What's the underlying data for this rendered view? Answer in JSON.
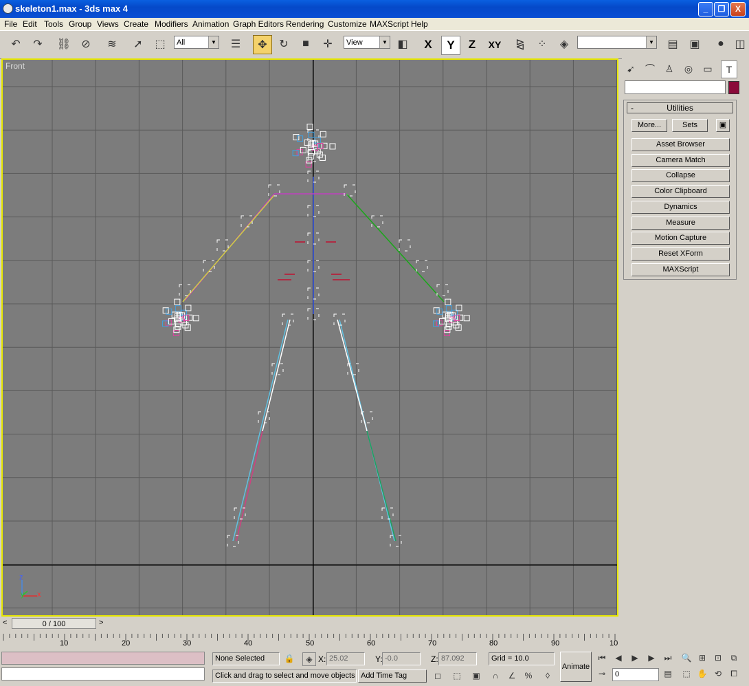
{
  "window": {
    "title": "skeleton1.max - 3ds max 4",
    "minimize": "_",
    "maximize": "❐",
    "close": "X"
  },
  "menu": [
    "File",
    "Edit",
    "Tools",
    "Group",
    "Views",
    "Create",
    "Modifiers",
    "Animation",
    "Graph Editors",
    "Rendering",
    "Customize",
    "MAXScript",
    "Help"
  ],
  "toolbar": {
    "selection_filter": "All",
    "ref_coord": "View",
    "axis_x": "X",
    "axis_y": "Y",
    "axis_z": "Z",
    "axis_xy": "XY",
    "named_selection": "",
    "icons": [
      "undo-icon",
      "redo-icon",
      "link-icon",
      "unlink-icon",
      "bind-spacewarp-icon",
      "select-icon",
      "select-region-icon",
      "select-by-name-icon",
      "move-icon",
      "rotate-icon",
      "scale-icon",
      "manipulate-icon",
      "pivot-icon",
      "mirror-icon",
      "array-icon",
      "align-icon",
      "track-view-icon",
      "schematic-icon",
      "material-editor-icon",
      "render-icon"
    ]
  },
  "viewport": {
    "label": "Front",
    "gizmo_z": "z",
    "gizmo_x": "x",
    "gizmo_y": "y",
    "border_color": "#e6e600",
    "bg_color": "#7c7c7c"
  },
  "command_panel": {
    "tabs": [
      "create-icon",
      "modify-icon",
      "hierarchy-icon",
      "motion-icon",
      "display-icon",
      "utilities-icon"
    ],
    "name_value": "",
    "color": "#8b0a3a",
    "rollout_toggle": "-",
    "rollout_title": "Utilities",
    "more_button": "More...",
    "sets_button": "Sets",
    "utilities": [
      "Asset Browser",
      "Camera Match",
      "Collapse",
      "Color Clipboard",
      "Dynamics",
      "Measure",
      "Motion Capture",
      "Reset XForm",
      "MAXScript"
    ]
  },
  "timeline": {
    "slider_text": "0 / 100",
    "prev": "<",
    "next": ">",
    "ticks": [
      "10",
      "20",
      "30",
      "40",
      "50",
      "60",
      "70",
      "80",
      "90",
      "10"
    ]
  },
  "status": {
    "selection": "None Selected",
    "x_label": "X:",
    "x_value": "25.02",
    "y_label": "Y:",
    "y_value": "-0.0",
    "z_label": "Z:",
    "z_value": "87.092",
    "grid": "Grid = 10.0",
    "prompt": "Click and drag to select and move objects",
    "add_time_tag": "Add Time Tag",
    "animate": "Animate",
    "frame_value": "0"
  }
}
